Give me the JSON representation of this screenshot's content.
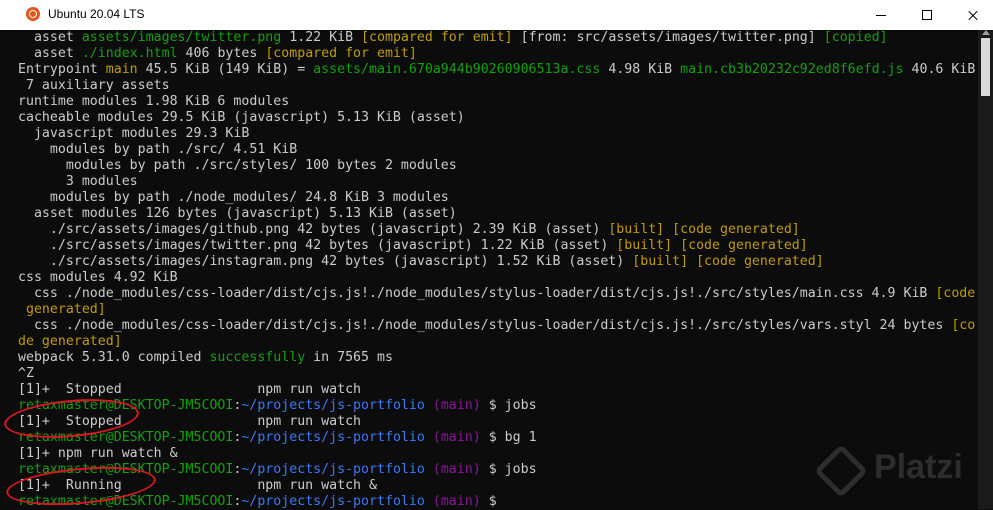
{
  "window": {
    "title": "Ubuntu 20.04 LTS"
  },
  "terminal": {
    "colors": {
      "background": "#0c0c0c",
      "text": "#cccccc",
      "green": "#13a10e",
      "yellow": "#c19c00",
      "blue": "#3b78ff",
      "purple": "#881798"
    },
    "lines": [
      [
        [
          "  asset ",
          ""
        ],
        [
          "assets/images/twitter.png",
          "g"
        ],
        [
          " 1.22 KiB ",
          ""
        ],
        [
          "[compared for emit]",
          "y"
        ],
        [
          " [from: src/assets/images/twitter.png] ",
          ""
        ],
        [
          "[copied]",
          "g"
        ]
      ],
      [
        [
          "  asset ",
          ""
        ],
        [
          "./index.html",
          "g"
        ],
        [
          " 406 bytes ",
          ""
        ],
        [
          "[compared for emit]",
          "y"
        ]
      ],
      [
        [
          "Entrypoint ",
          ""
        ],
        [
          "main",
          "y"
        ],
        [
          " 45.5 KiB (149 KiB) = ",
          ""
        ],
        [
          "assets/main.670a944b90260906513a.css",
          "g"
        ],
        [
          " 4.98 KiB ",
          ""
        ],
        [
          "main.cb3b20232c92ed8f6efd.js",
          "g"
        ],
        [
          " 40.6 KiB",
          ""
        ]
      ],
      [
        [
          " 7 auxiliary assets",
          ""
        ]
      ],
      [
        [
          "runtime modules 1.98 KiB 6 modules",
          ""
        ]
      ],
      [
        [
          "cacheable modules 29.5 KiB (javascript) 5.13 KiB (asset)",
          ""
        ]
      ],
      [
        [
          "  javascript modules 29.3 KiB",
          ""
        ]
      ],
      [
        [
          "    modules by path ./src/ 4.51 KiB",
          ""
        ]
      ],
      [
        [
          "      modules by path ./src/styles/ 100 bytes 2 modules",
          ""
        ]
      ],
      [
        [
          "      3 modules",
          ""
        ]
      ],
      [
        [
          "    modules by path ./node_modules/ 24.8 KiB 3 modules",
          ""
        ]
      ],
      [
        [
          "  asset modules 126 bytes (javascript) 5.13 KiB (asset)",
          ""
        ]
      ],
      [
        [
          "    ./src/assets/images/github.png 42 bytes (javascript) 2.39 KiB (asset) ",
          ""
        ],
        [
          "[built]",
          "y"
        ],
        [
          " ",
          ""
        ],
        [
          "[code generated]",
          "y"
        ]
      ],
      [
        [
          "    ./src/assets/images/twitter.png 42 bytes (javascript) 1.22 KiB (asset) ",
          ""
        ],
        [
          "[built]",
          "y"
        ],
        [
          " ",
          ""
        ],
        [
          "[code generated]",
          "y"
        ]
      ],
      [
        [
          "    ./src/assets/images/instagram.png 42 bytes (javascript) 1.52 KiB (asset) ",
          ""
        ],
        [
          "[built]",
          "y"
        ],
        [
          " ",
          ""
        ],
        [
          "[code generated]",
          "y"
        ]
      ],
      [
        [
          "css modules 4.92 KiB",
          ""
        ]
      ],
      [
        [
          "  css ./node_modules/css-loader/dist/cjs.js!./node_modules/stylus-loader/dist/cjs.js!./src/styles/main.css 4.9 KiB ",
          ""
        ],
        [
          "[code",
          "y"
        ]
      ],
      [
        [
          " generated]",
          "y"
        ]
      ],
      [
        [
          "  css ./node_modules/css-loader/dist/cjs.js!./node_modules/stylus-loader/dist/cjs.js!./src/styles/vars.styl 24 bytes ",
          ""
        ],
        [
          "[co",
          "y"
        ]
      ],
      [
        [
          "de generated]",
          "y"
        ]
      ],
      [
        [
          "webpack 5.31.0 compiled ",
          ""
        ],
        [
          "successfully",
          "g"
        ],
        [
          " in 7565 ms",
          ""
        ]
      ],
      [
        [
          "^Z",
          ""
        ]
      ],
      [
        [
          "[1]+  Stopped                 npm run watch",
          ""
        ]
      ],
      [
        [
          "retaxmaster@DESKTOP-JM5COOI",
          "g"
        ],
        [
          ":",
          ""
        ],
        [
          "~/projects/js-portfolio",
          "b"
        ],
        [
          " ",
          ""
        ],
        [
          "(main)",
          "p"
        ],
        [
          " $ jobs",
          ""
        ]
      ],
      [
        [
          "[1]+  Stopped                 npm run watch",
          ""
        ]
      ],
      [
        [
          "retaxmaster@DESKTOP-JM5COOI",
          "g"
        ],
        [
          ":",
          ""
        ],
        [
          "~/projects/js-portfolio",
          "b"
        ],
        [
          " ",
          ""
        ],
        [
          "(main)",
          "p"
        ],
        [
          " $ bg 1",
          ""
        ]
      ],
      [
        [
          "[1]+ npm run watch &",
          ""
        ]
      ],
      [
        [
          "retaxmaster@DESKTOP-JM5COOI",
          "g"
        ],
        [
          ":",
          ""
        ],
        [
          "~/projects/js-portfolio",
          "b"
        ],
        [
          " ",
          ""
        ],
        [
          "(main)",
          "p"
        ],
        [
          " $ jobs",
          ""
        ]
      ],
      [
        [
          "[1]+  Running                 npm run watch &",
          ""
        ]
      ],
      [
        [
          "retaxmaster@DESKTOP-JM5COOI",
          "g"
        ],
        [
          ":",
          ""
        ],
        [
          "~/projects/js-portfolio",
          "b"
        ],
        [
          " ",
          ""
        ],
        [
          "(main)",
          "p"
        ],
        [
          " $",
          ""
        ]
      ]
    ]
  },
  "annotations": {
    "circle_color": "#d7191e"
  },
  "watermark": {
    "text": "Platzi"
  }
}
